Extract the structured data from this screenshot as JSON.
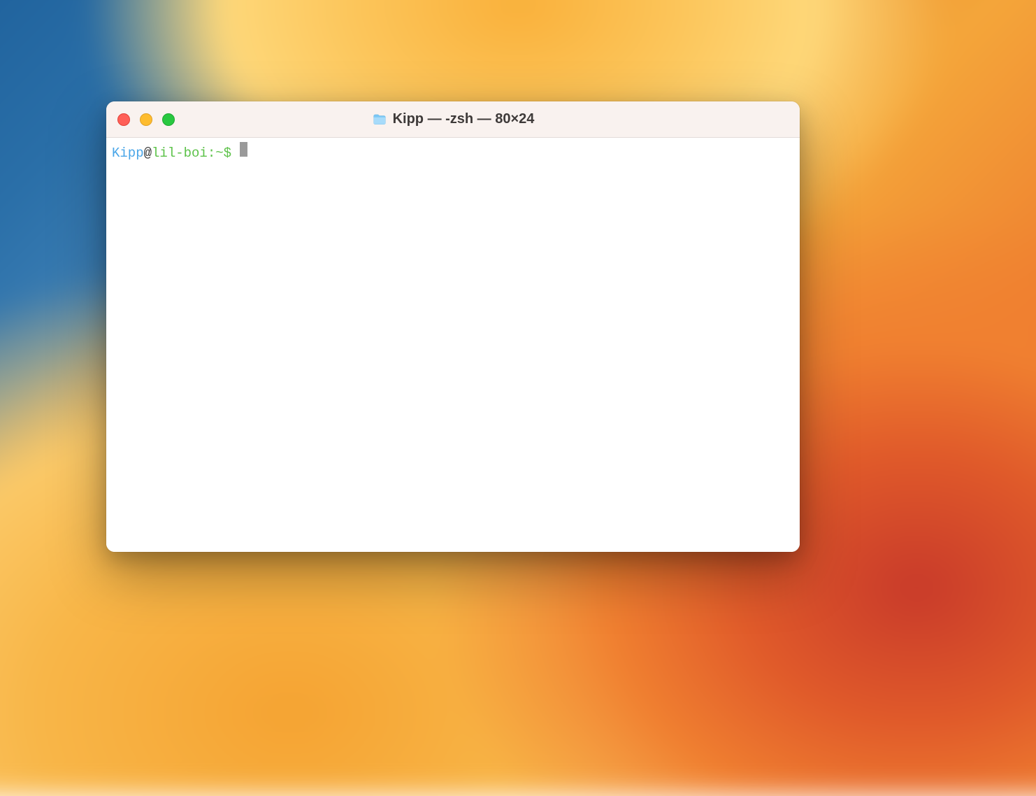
{
  "window": {
    "title": "Kipp — -zsh — 80×24"
  },
  "prompt": {
    "user": "Kipp",
    "at": "@",
    "host": "lil-boi",
    "separator": ":",
    "path": "~",
    "symbol": "$",
    "space": " "
  },
  "colors": {
    "user": "#4aa6e8",
    "host": "#5dc24a",
    "close": "#ff5f57",
    "minimize": "#febc2e",
    "zoom": "#28c840"
  }
}
